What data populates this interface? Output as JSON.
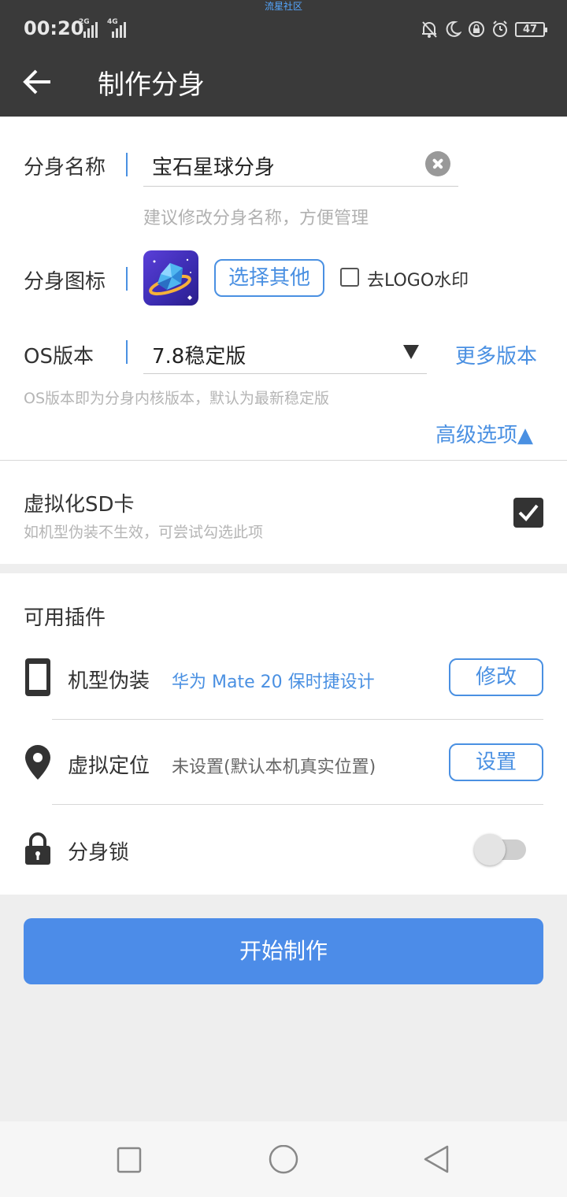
{
  "status_bar": {
    "watermark": "流星社区",
    "time": "00:20",
    "network_1": "2G",
    "network_2": "4G",
    "battery": "47"
  },
  "header": {
    "title": "制作分身",
    "back_icon": "arrow-left-icon"
  },
  "form": {
    "name_label": "分身名称",
    "name_value": "宝石星球分身",
    "name_hint": "建议修改分身名称，方便管理",
    "icon_label": "分身图标",
    "choose_other": "选择其他",
    "remove_logo_label": "去LOGO水印",
    "remove_logo_checked": false,
    "os_label": "OS版本",
    "os_value": "7.8稳定版",
    "more_versions": "更多版本",
    "os_hint": "OS版本即为分身内核版本，默认为最新稳定版",
    "advanced": "高级选项▲"
  },
  "sd_card": {
    "title": "虚拟化SD卡",
    "subtitle": "如机型伪装不生效，可尝试勾选此项",
    "checked": true
  },
  "plugins": {
    "title": "可用插件",
    "items": [
      {
        "icon": "phone-icon",
        "label": "机型伪装",
        "value": "华为 Mate 20 保时捷设计",
        "value_color": "#4a90e2",
        "action": "修改"
      },
      {
        "icon": "location-pin-icon",
        "label": "虚拟定位",
        "value": "未设置(默认本机真实位置)",
        "value_color": "#666666",
        "action": "设置"
      },
      {
        "icon": "lock-icon",
        "label": "分身锁",
        "toggle_on": false
      }
    ]
  },
  "start_button": "开始制作",
  "colors": {
    "accent": "#4a90e2",
    "primary_button": "#4c8ce8",
    "header_bg": "#3a3a3a"
  }
}
